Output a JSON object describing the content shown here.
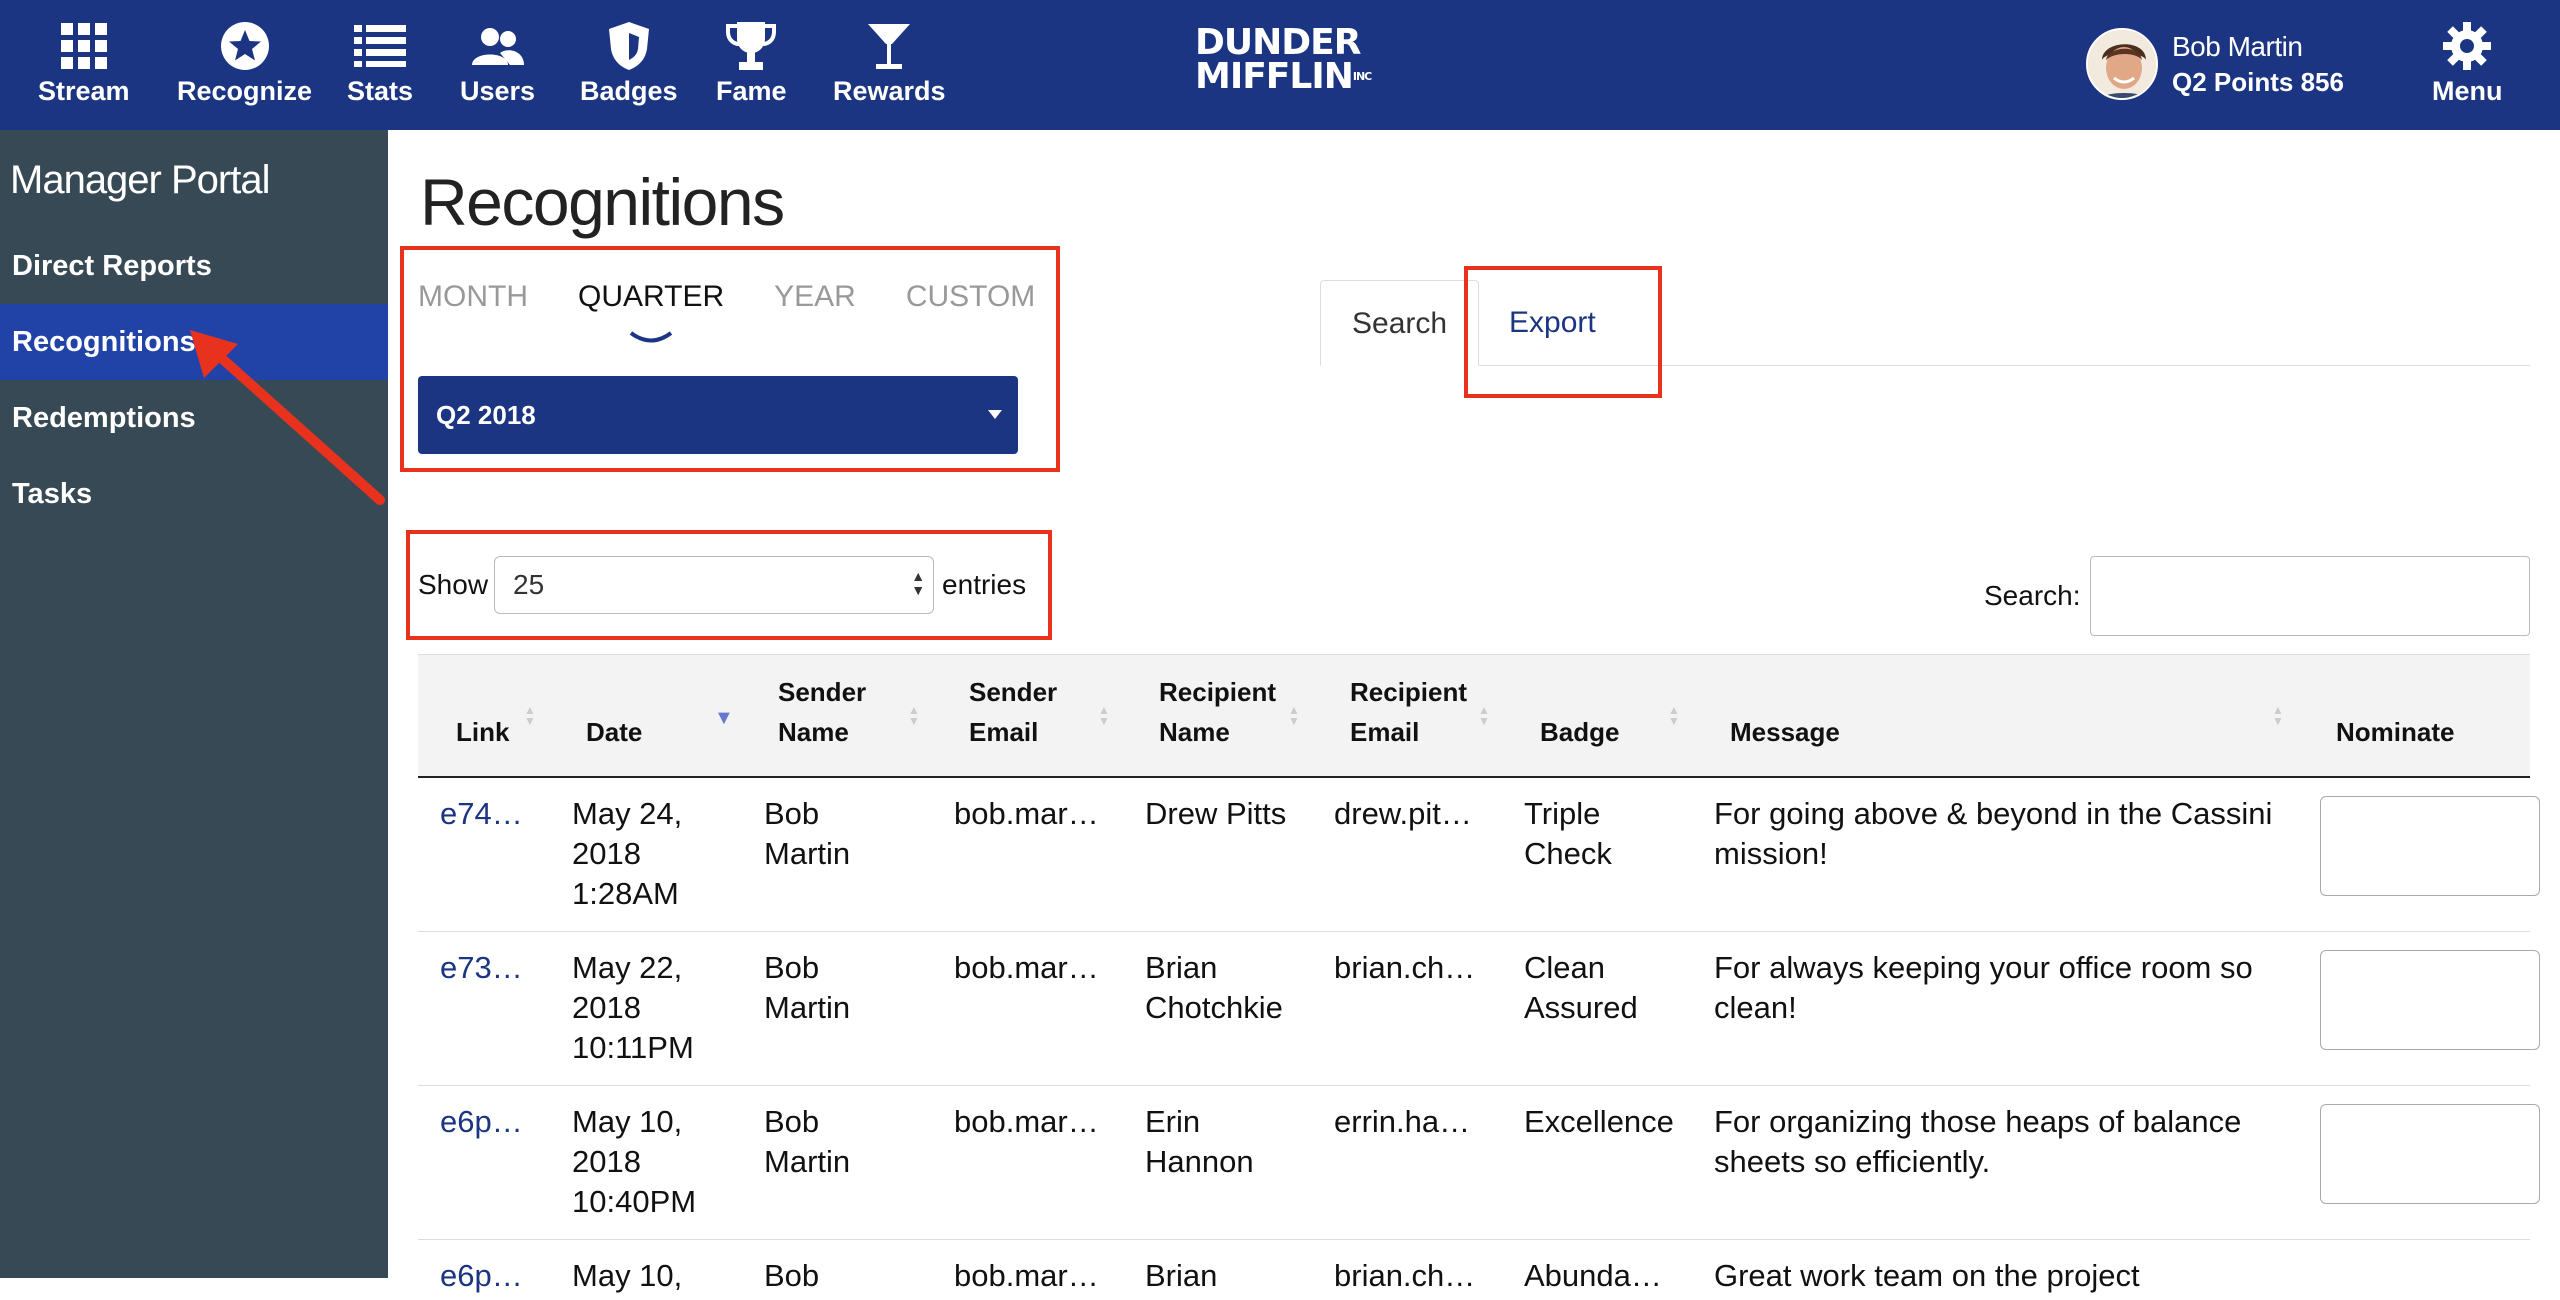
{
  "nav": {
    "items": [
      {
        "label": "Stream",
        "icon": "grid-icon"
      },
      {
        "label": "Recognize",
        "icon": "star-badge-icon"
      },
      {
        "label": "Stats",
        "icon": "list-icon"
      },
      {
        "label": "Users",
        "icon": "users-icon"
      },
      {
        "label": "Badges",
        "icon": "shield-icon"
      },
      {
        "label": "Fame",
        "icon": "trophy-icon"
      },
      {
        "label": "Rewards",
        "icon": "cocktail-icon"
      }
    ],
    "logo_line1": "DUNDER",
    "logo_line2": "MIFFLIN",
    "logo_inc": "INC",
    "user_name": "Bob Martin",
    "user_points": "Q2 Points 856",
    "menu_label": "Menu"
  },
  "sidebar": {
    "title": "Manager Portal",
    "items": [
      {
        "label": "Direct Reports"
      },
      {
        "label": "Recognitions"
      },
      {
        "label": "Redemptions"
      },
      {
        "label": "Tasks"
      }
    ]
  },
  "main": {
    "title": "Recognitions",
    "period_tabs": [
      "MONTH",
      "QUARTER",
      "YEAR",
      "CUSTOM"
    ],
    "selected_period": "Q2 2018",
    "tabs": {
      "search": "Search",
      "export": "Export"
    },
    "show_label": "Show",
    "entries_value": "25",
    "entries_label": "entries",
    "search_label": "Search:"
  },
  "table": {
    "headers": {
      "link": "Link",
      "date": "Date",
      "sender_name_1": "Sender",
      "sender_name_2": "Name",
      "sender_email_1": "Sender",
      "sender_email_2": "Email",
      "recipient_name_1": "Recipient",
      "recipient_name_2": "Name",
      "recipient_email_1": "Recipient",
      "recipient_email_2": "Email",
      "badge": "Badge",
      "message": "Message",
      "nominate": "Nominate"
    },
    "rows": [
      {
        "link": "e74…",
        "date1": "May 24,",
        "date2": "2018",
        "date3": "1:28AM",
        "sender1": "Bob",
        "sender2": "Martin",
        "sender_email": "bob.mar…",
        "recipient1": "Drew Pitts",
        "recipient2": "",
        "recipient_email": "drew.pit…",
        "badge1": "Triple",
        "badge2": "Check",
        "message1": "For going above & beyond in the Cassini",
        "message2": "mission!"
      },
      {
        "link": "e73…",
        "date1": "May 22,",
        "date2": "2018",
        "date3": "10:11PM",
        "sender1": "Bob",
        "sender2": "Martin",
        "sender_email": "bob.mar…",
        "recipient1": "Brian",
        "recipient2": "Chotchkie",
        "recipient_email": "brian.ch…",
        "badge1": "Clean",
        "badge2": "Assured",
        "message1": "For always keeping your office room so",
        "message2": "clean!"
      },
      {
        "link": "e6p…",
        "date1": "May 10,",
        "date2": "2018",
        "date3": "10:40PM",
        "sender1": "Bob",
        "sender2": "Martin",
        "sender_email": "bob.mar…",
        "recipient1": "Erin",
        "recipient2": "Hannon",
        "recipient_email": "errin.ha…",
        "badge1": "Excellence",
        "badge2": "",
        "message1": "For organizing those heaps of balance",
        "message2": "sheets so efficiently."
      },
      {
        "link": "e6p…",
        "date1": "May 10,",
        "date2": "",
        "date3": "",
        "sender1": "Bob",
        "sender2": "",
        "sender_email": "bob.mar…",
        "recipient1": "Brian",
        "recipient2": "",
        "recipient_email": "brian.ch…",
        "badge1": "Abunda…",
        "badge2": "",
        "message1": "Great work team on the project",
        "message2": ""
      }
    ]
  },
  "colors": {
    "brand_navy": "#1c3582",
    "sidebar": "#374955",
    "sidebar_active": "#2143a8",
    "annotation_red": "#e8321e"
  }
}
